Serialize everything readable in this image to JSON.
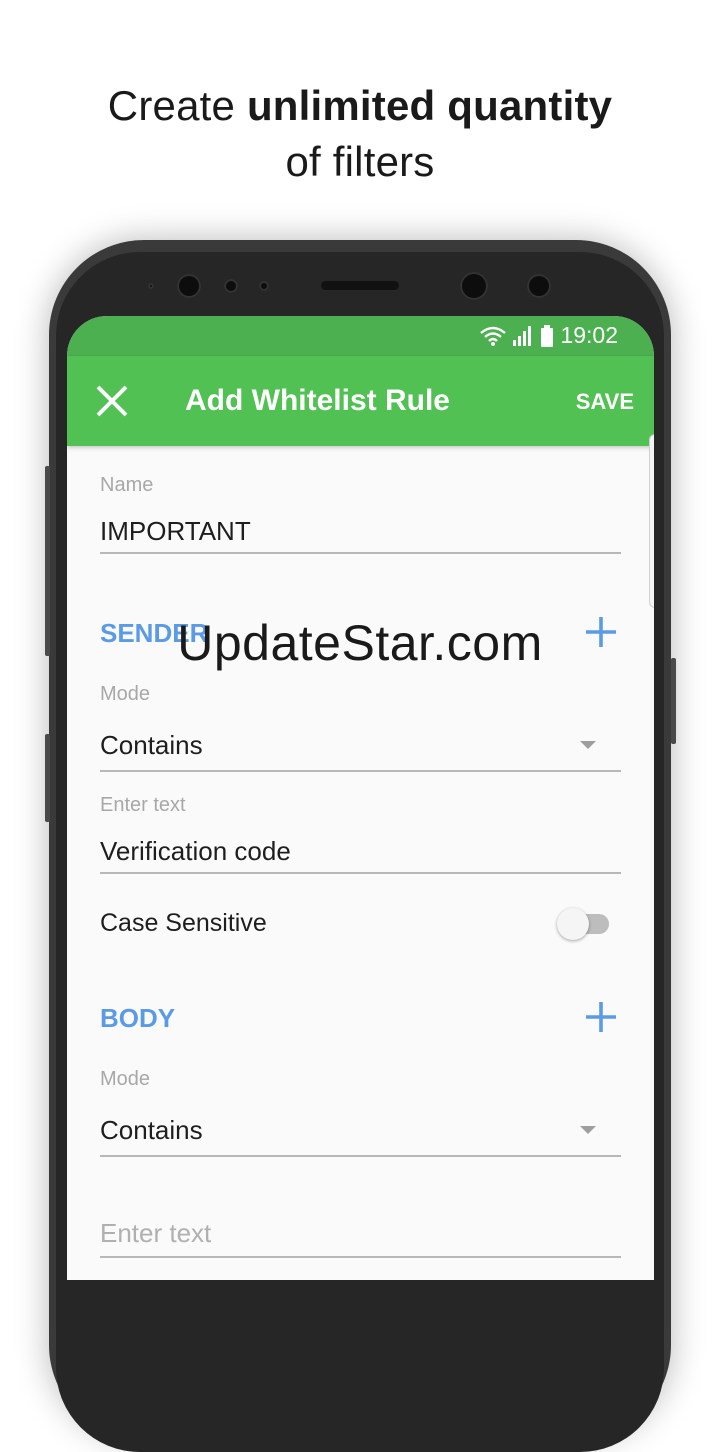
{
  "headline": {
    "line1_prefix": "Create ",
    "line1_bold": "unlimited quantity",
    "line2": "of filters"
  },
  "status_bar": {
    "time": "19:02",
    "icons": [
      "wifi-icon",
      "signal-icon",
      "battery-icon"
    ]
  },
  "app_bar": {
    "close_icon": "close-icon",
    "title": "Add Whitelist Rule",
    "save_label": "SAVE"
  },
  "form": {
    "name": {
      "label": "Name",
      "value": "IMPORTANT"
    },
    "sender": {
      "title": "SENDER",
      "mode_label": "Mode",
      "mode_value": "Contains",
      "text_label": "Enter text",
      "text_value": "Verification code",
      "case_sensitive_label": "Case Sensitive",
      "case_sensitive_on": false
    },
    "body": {
      "title": "BODY",
      "mode_label": "Mode",
      "mode_value": "Contains",
      "text_placeholder": "Enter text"
    }
  },
  "watermark": "UpdateStar.com",
  "colors": {
    "statusbar": "#4caf50",
    "appbar": "#52c153",
    "section_title": "#5b9be6",
    "phone_frame": "#3a3a3a"
  }
}
